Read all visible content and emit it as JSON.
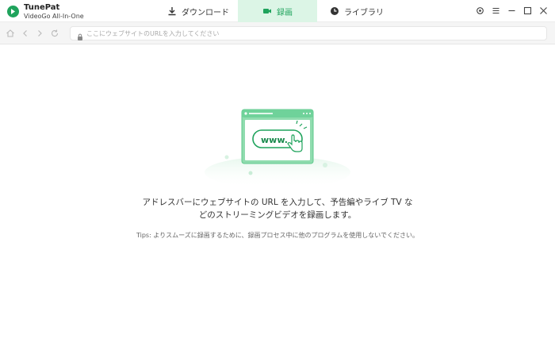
{
  "app": {
    "name": "TunePat",
    "subtitle": "VideoGo All-In-One"
  },
  "tabs": [
    {
      "label": "ダウンロード",
      "icon": "download-icon",
      "active": false
    },
    {
      "label": "録画",
      "icon": "video-camera-icon",
      "active": true
    },
    {
      "label": "ライブラリ",
      "icon": "clock-icon",
      "active": false
    }
  ],
  "window_controls": [
    "settings-icon",
    "menu-icon",
    "minimize-icon",
    "maximize-icon",
    "close-icon"
  ],
  "address": {
    "placeholder": "ここにウェブサイトのURLを入力してください",
    "value": ""
  },
  "illustration": {
    "label": "www."
  },
  "main": {
    "line1": "アドレスバーにウェブサイトの URL を入力して、予告編やライブ TV な",
    "line2": "どのストリーミングビデオを録画します。",
    "tips": "Tips: よりスムーズに録画するために、録画プロセス中に他のプログラムを使用しないでください。"
  },
  "colors": {
    "accent": "#1fa35c",
    "active_tab_bg": "#dcf5e6"
  }
}
